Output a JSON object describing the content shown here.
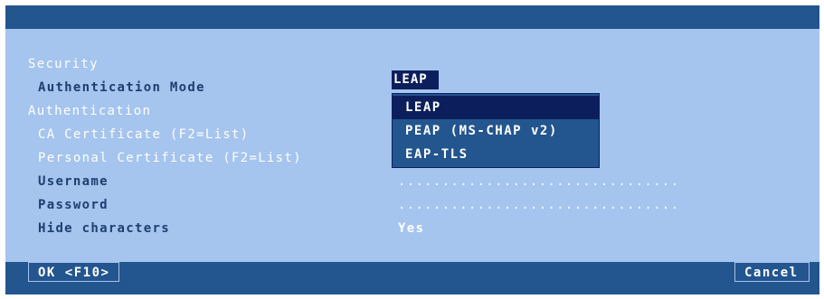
{
  "form": {
    "security_heading": "Security",
    "auth_mode_label": "Authentication Mode",
    "auth_mode_value": "LEAP",
    "authentication_heading": "Authentication",
    "ca_cert_label": "CA Certificate (F2=List)",
    "personal_cert_label": "Personal Certificate (F2=List)",
    "username_label": "Username",
    "username_value": "................................",
    "password_label": "Password",
    "password_value": "................................",
    "hide_chars_label": "Hide characters",
    "hide_chars_value": "Yes"
  },
  "dropdown": {
    "options": [
      "LEAP",
      "PEAP (MS-CHAP v2)",
      "EAP-TLS"
    ],
    "selected_index": 0
  },
  "buttons": {
    "ok": "OK <F10>",
    "cancel": "Cancel"
  },
  "colors": {
    "content_bg": "#a5c4ee",
    "bar_bg": "#23558f",
    "selection_bg": "#0c1f5c"
  }
}
